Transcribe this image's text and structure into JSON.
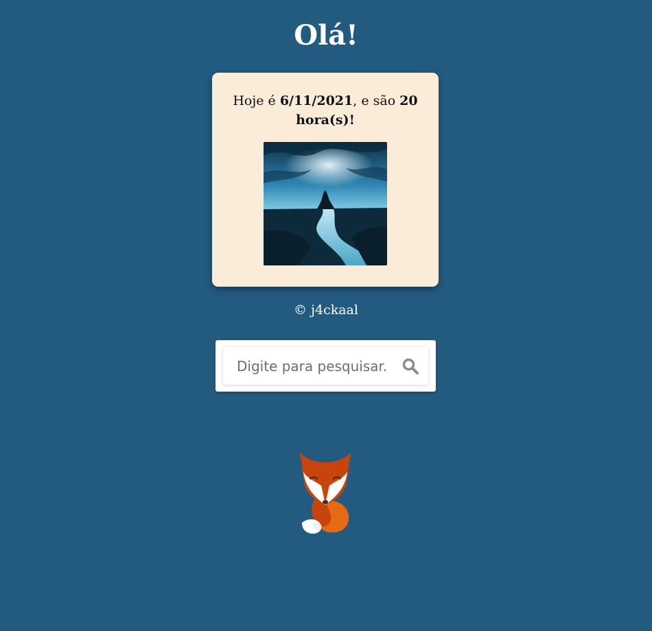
{
  "header": {
    "title": "Olá!"
  },
  "card": {
    "text_prefix": "Hoje é ",
    "date": "6/11/2021",
    "text_middle": ", e são ",
    "hours": "20 hora(s)!",
    "image_icon": "landscape-photo-icon"
  },
  "footer": {
    "copyright": "© j4ckaal"
  },
  "search": {
    "placeholder": "Digite para pesquisar...",
    "value": "",
    "button_icon": "search-icon"
  },
  "mascot": {
    "icon": "fox-icon"
  },
  "colors": {
    "background": "#235a80",
    "card": "#faecd8",
    "text_light": "#ffffff",
    "text_dark": "#111111"
  }
}
